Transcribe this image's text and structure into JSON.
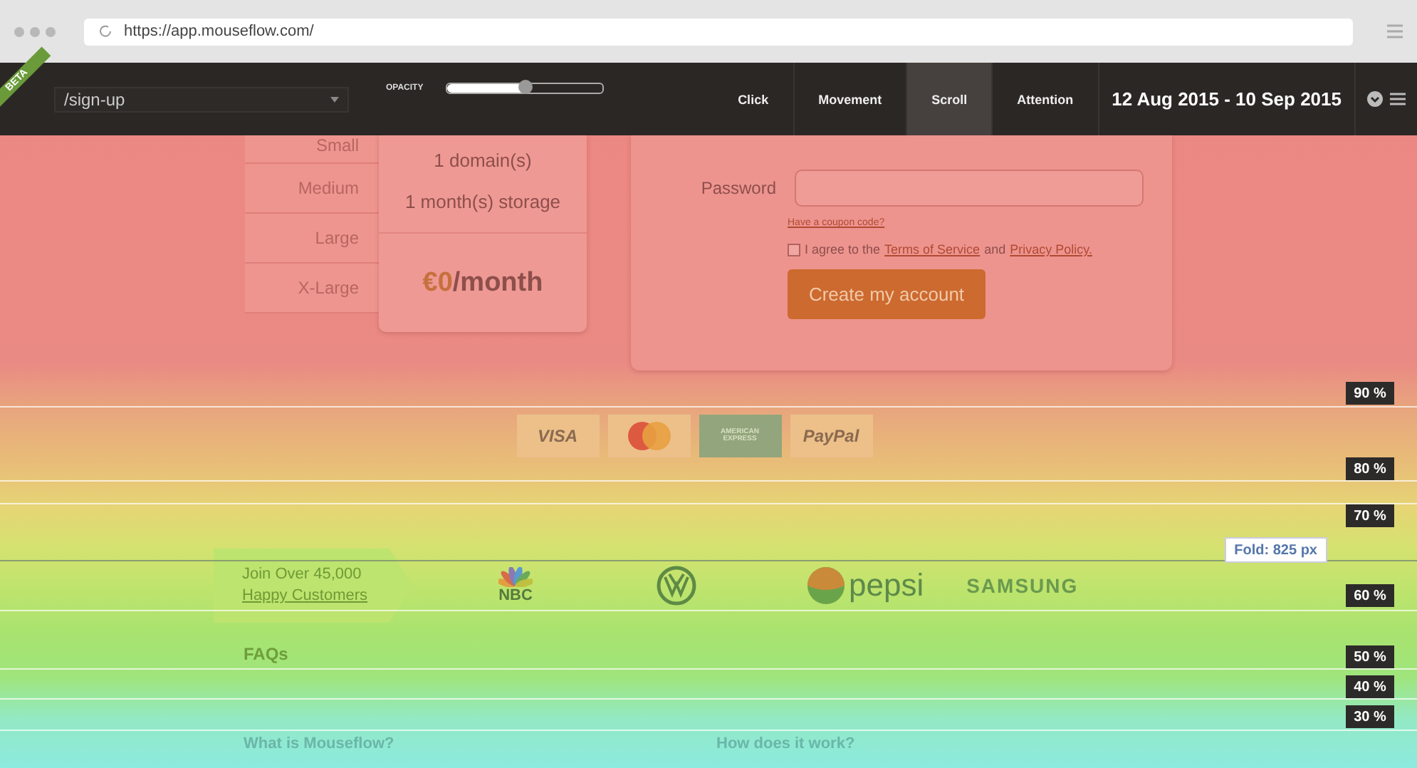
{
  "browser": {
    "url": "https://app.mouseflow.com/"
  },
  "toolbar": {
    "badge": "BETA",
    "page_select": "/sign-up",
    "opacity": {
      "label": "OPACITY",
      "level": 0.5
    },
    "tabs": [
      {
        "label": "Click",
        "selected": false
      },
      {
        "label": "Movement",
        "selected": false
      },
      {
        "label": "Scroll",
        "selected": true
      },
      {
        "label": "Attention",
        "selected": false
      }
    ],
    "date_range": "12 Aug 2015 - 10 Sep 2015"
  },
  "page": {
    "plans": [
      {
        "label": "Small"
      },
      {
        "label": "Medium"
      },
      {
        "label": "Large"
      },
      {
        "label": "X-Large"
      }
    ],
    "plan_details": [
      "1 domain(s)",
      "1 month(s) storage"
    ],
    "price": {
      "amount": "€0",
      "unit": "/month"
    },
    "form": {
      "password_label": "Password",
      "coupon_link": "Have a coupon code?",
      "agree_checked": false,
      "agree_parts": [
        {
          "kind": "text",
          "text": "I agree to the"
        },
        {
          "kind": "link",
          "text": "Terms of Service"
        },
        {
          "kind": "text",
          "text": "and"
        },
        {
          "kind": "link",
          "text": "Privacy Policy."
        }
      ],
      "button": "Create my account"
    },
    "payments": [
      {
        "kind": "text",
        "label": "VISA"
      },
      {
        "kind": "mastercard"
      },
      {
        "kind": "amex",
        "label": "AMERICAN EXPRESS"
      },
      {
        "kind": "text",
        "label": "PayPal"
      }
    ],
    "customers": {
      "heading_lines": [
        "Join Over 45,000",
        "Happy Customers"
      ],
      "logos": [
        {
          "kind": "peacock",
          "label": "NBC"
        },
        {
          "kind": "vw"
        },
        {
          "kind": "globe",
          "label": "pepsi"
        },
        {
          "kind": "text",
          "label": "SAMSUNG"
        }
      ]
    },
    "faq": {
      "title": "FAQs",
      "questions": [
        "What is Mouseflow?",
        "How does it work?"
      ]
    }
  },
  "scroll_markers": [
    {
      "label": "90 %"
    },
    {
      "label": "80 %"
    },
    {
      "label": "70 %"
    },
    {
      "label": "60 %"
    },
    {
      "label": "50 %"
    },
    {
      "label": "40 %"
    },
    {
      "label": "30 %"
    }
  ],
  "fold": {
    "label": "Fold: 825 px"
  }
}
